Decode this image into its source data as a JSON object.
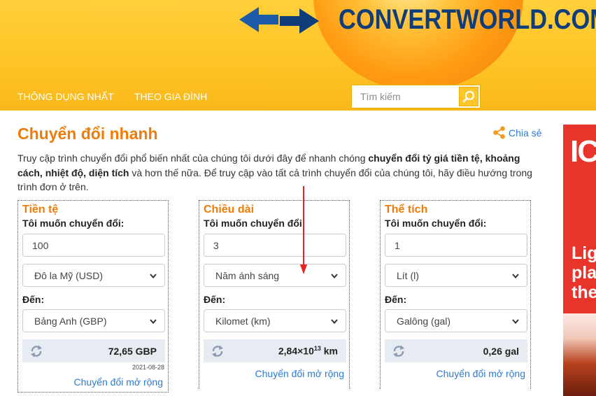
{
  "header": {
    "logo_text": "CONVERTWORLD.COM",
    "nav": [
      "THÔNG DỤNG NHẤT",
      "THEO GIA ĐÌNH"
    ],
    "search_placeholder": "Tìm kiếm"
  },
  "main": {
    "title": "Chuyển đổi nhanh",
    "share_label": "Chia sẻ",
    "intro": {
      "p1": "Truy cập trình chuyển đổi phổ biến nhất của chúng tôi dưới đây để nhanh chóng ",
      "b1": "chuyển đổi tỷ giá tiền tệ, khoảng cách, nhiệt độ, diện tích",
      "p2": " và hơn thế nữa. Để truy cập vào tất cả trình chuyển đổi của chúng tôi, hãy điều hướng trong trình đơn ở trên."
    }
  },
  "cards": [
    {
      "title": "Tiền tệ",
      "from_label": "Tôi muốn chuyển đổi:",
      "value": "100",
      "from_unit": "Đô la Mỹ (USD)",
      "to_label": "Đến:",
      "to_unit": "Bảng Anh (GBP)",
      "result": "72,65 GBP",
      "date": "2021-08-28",
      "more": "Chuyển đổi mở rộng"
    },
    {
      "title": "Chiều dài",
      "from_label": "Tôi muốn chuyển đổi:",
      "value": "3",
      "from_unit": "Năm ánh sáng",
      "to_label": "Đến:",
      "to_unit": "Kilomet (km)",
      "result_base": "2,84×10",
      "result_exp": "13",
      "result_unit": " km",
      "more": "Chuyển đổi mở rộng"
    },
    {
      "title": "Thể tích",
      "from_label": "Tôi muốn chuyển đổi:",
      "value": "1",
      "from_unit": "Lít (l)",
      "to_label": "Đến:",
      "to_unit": "Galông (gal)",
      "result": "0,26 gal",
      "more": "Chuyển đổi mở rộng"
    }
  ],
  "ad": {
    "top_text": "IC",
    "lines": [
      "Lig",
      "pla",
      "the"
    ]
  },
  "colors": {
    "accent_orange": "#f07c08",
    "link_blue": "#2b7bd1",
    "header_yellow": "#ffc629",
    "logo_navy": "#0e3d79"
  }
}
